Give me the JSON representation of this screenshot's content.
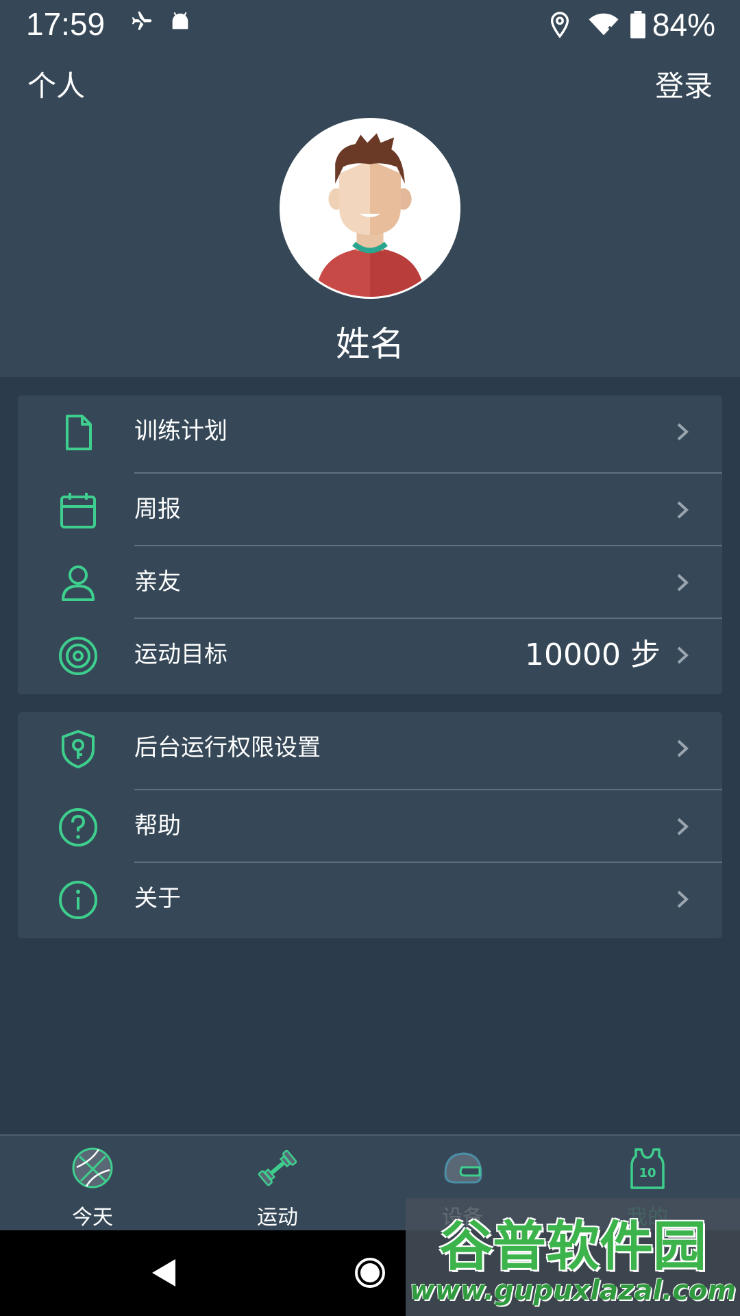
{
  "status_bar": {
    "time": "17:59",
    "battery_percent": "84%",
    "icons": [
      "airplane-off-icon",
      "android-icon",
      "location-icon",
      "wifi-icon",
      "battery-icon"
    ]
  },
  "top_bar": {
    "title": "个人",
    "login_label": "登录"
  },
  "profile": {
    "avatar_icon": "avatar-icon",
    "name": "姓名"
  },
  "menu_group_1": [
    {
      "label": "训练计划",
      "icon": "document-icon"
    },
    {
      "label": "周报",
      "icon": "calendar-icon"
    },
    {
      "label": "亲友",
      "icon": "person-icon"
    },
    {
      "label": "运动目标",
      "icon": "target-icon",
      "value": "10000 步"
    }
  ],
  "menu_group_2": [
    {
      "label": "后台运行权限设置",
      "icon": "shield-key-icon"
    },
    {
      "label": "帮助",
      "icon": "help-icon"
    },
    {
      "label": "关于",
      "icon": "info-icon"
    }
  ],
  "bottom_nav": {
    "items": [
      {
        "label": "今天",
        "icon": "basketball-icon",
        "active": false
      },
      {
        "label": "运动",
        "icon": "dumbbell-icon",
        "active": false
      },
      {
        "label": "设备",
        "icon": "helmet-icon",
        "active": false
      },
      {
        "label": "我的",
        "icon": "jersey-icon",
        "active": true,
        "badge": "10"
      }
    ]
  },
  "colors": {
    "accent": "#3ecf8e",
    "header_bg": "#364857",
    "page_bg": "#2c3b4b",
    "card_bg": "#364857",
    "divider": "#607080"
  },
  "watermark": {
    "title": "谷普软件园",
    "url": "www.gupuxlazal.com"
  }
}
